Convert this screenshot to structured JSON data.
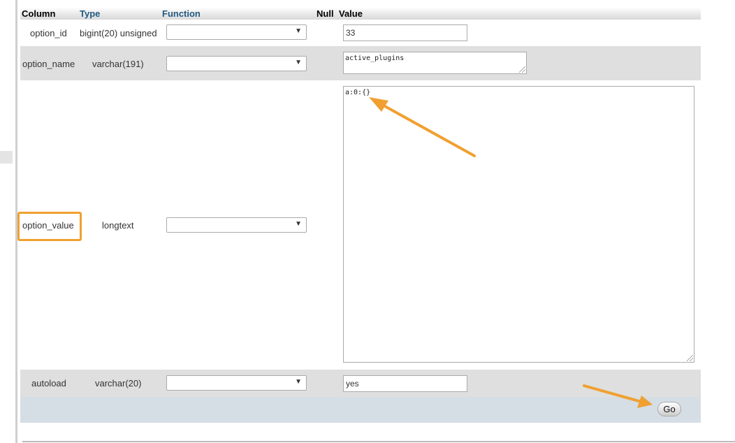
{
  "header": {
    "column": "Column",
    "type": "Type",
    "function": "Function",
    "null": "Null",
    "value": "Value"
  },
  "rows": [
    {
      "column": "option_id",
      "type": "bigint(20) unsigned",
      "function": "",
      "value": "33"
    },
    {
      "column": "option_name",
      "type": "varchar(191)",
      "function": "",
      "value": "active_plugins"
    },
    {
      "column": "option_value",
      "type": "longtext",
      "function": "",
      "value": "a:0:{}"
    },
    {
      "column": "autoload",
      "type": "varchar(20)",
      "function": "",
      "value": "yes"
    }
  ],
  "go_button": "Go",
  "colors": {
    "annotation": "#f0a030",
    "header_link": "#235a81",
    "row_alt": "#dfdfdf",
    "footer": "#d5dde5"
  },
  "icons": {
    "dropdown": "triangle-down",
    "annotation_arrow": "orange-arrow"
  }
}
